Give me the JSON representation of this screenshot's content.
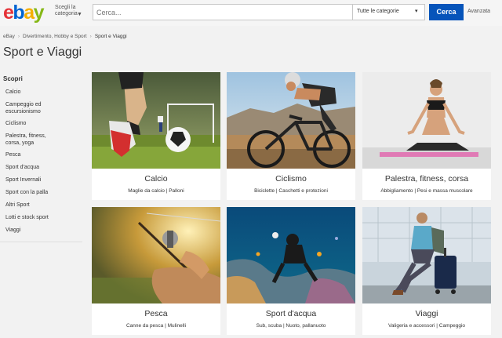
{
  "header": {
    "logo": {
      "e": "e",
      "b": "b",
      "a": "a",
      "y": "y"
    },
    "category_dropdown": "Scegli la categoria",
    "search_placeholder": "Cerca...",
    "category_select": "Tutte le categorie",
    "search_button": "Cerca",
    "advanced_link": "Avanzata"
  },
  "breadcrumb": [
    "eBay",
    "Divertimento, Hobby e Sport",
    "Sport e Viaggi"
  ],
  "page_title": "Sport e Viaggi",
  "sidebar": {
    "heading": "Scopri",
    "items": [
      "Calcio",
      "Campeggio ed escursionismo",
      "Ciclismo",
      "Palestra, fitness, corsa, yoga",
      "Pesca",
      "Sport d'acqua",
      "Sport Invernali",
      "Sport con la palla",
      "Altri Sport",
      "Lotti e stock sport",
      "Viaggi"
    ]
  },
  "cards": [
    {
      "title": "Calcio",
      "subtitle": "Maglie da calcio | Palloni"
    },
    {
      "title": "Ciclismo",
      "subtitle": "Biciclette | Caschetti e protezioni"
    },
    {
      "title": "Palestra, fitness, corsa",
      "subtitle": "Abbigliamento | Pesi e massa muscolare"
    },
    {
      "title": "Pesca",
      "subtitle": "Canne da pesca | Mulinelli"
    },
    {
      "title": "Sport d'acqua",
      "subtitle": "Sub, scuba | Nuoto, pallanuoto"
    },
    {
      "title": "Viaggi",
      "subtitle": "Valigeria e accessori | Campeggio"
    }
  ],
  "colors": {
    "accent": "#0654ba",
    "logo_red": "#e53238",
    "logo_blue": "#0064d2",
    "logo_yellow": "#f5af02",
    "logo_green": "#86b817"
  },
  "icons": [
    "chevron-down-icon",
    "breadcrumb-separator-icon"
  ]
}
